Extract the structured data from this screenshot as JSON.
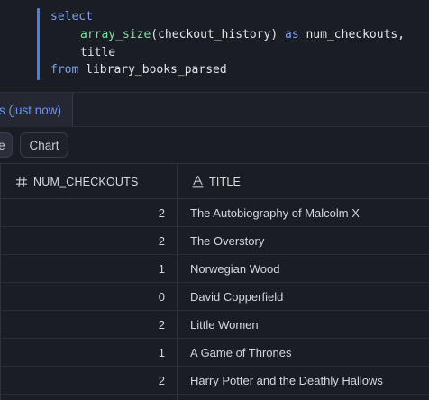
{
  "editor": {
    "line1": "select",
    "line2_fn": "array_size",
    "line2_args": "(checkout_history)",
    "line2_as": "as",
    "line2_alias": "num_checkouts,",
    "line3": "title",
    "line4_kw": "from",
    "line4_table": "library_books_parsed"
  },
  "results_tab": {
    "label": "s (just now)"
  },
  "view_toggle": {
    "table_label": "e",
    "chart_label": "Chart"
  },
  "grid": {
    "columns": [
      {
        "label": "NUM_CHECKOUTS",
        "type_icon": "hash-icon"
      },
      {
        "label": "TITLE",
        "type_icon": "text-type-icon"
      }
    ],
    "rows": [
      {
        "num_checkouts": "2",
        "title": "The Autobiography of Malcolm X"
      },
      {
        "num_checkouts": "2",
        "title": "The Overstory"
      },
      {
        "num_checkouts": "1",
        "title": "Norwegian Wood"
      },
      {
        "num_checkouts": "0",
        "title": "David Copperfield"
      },
      {
        "num_checkouts": "2",
        "title": "Little Women"
      },
      {
        "num_checkouts": "1",
        "title": "A Game of Thrones"
      },
      {
        "num_checkouts": "2",
        "title": "Harry Potter and the Deathly Hallows"
      }
    ]
  }
}
